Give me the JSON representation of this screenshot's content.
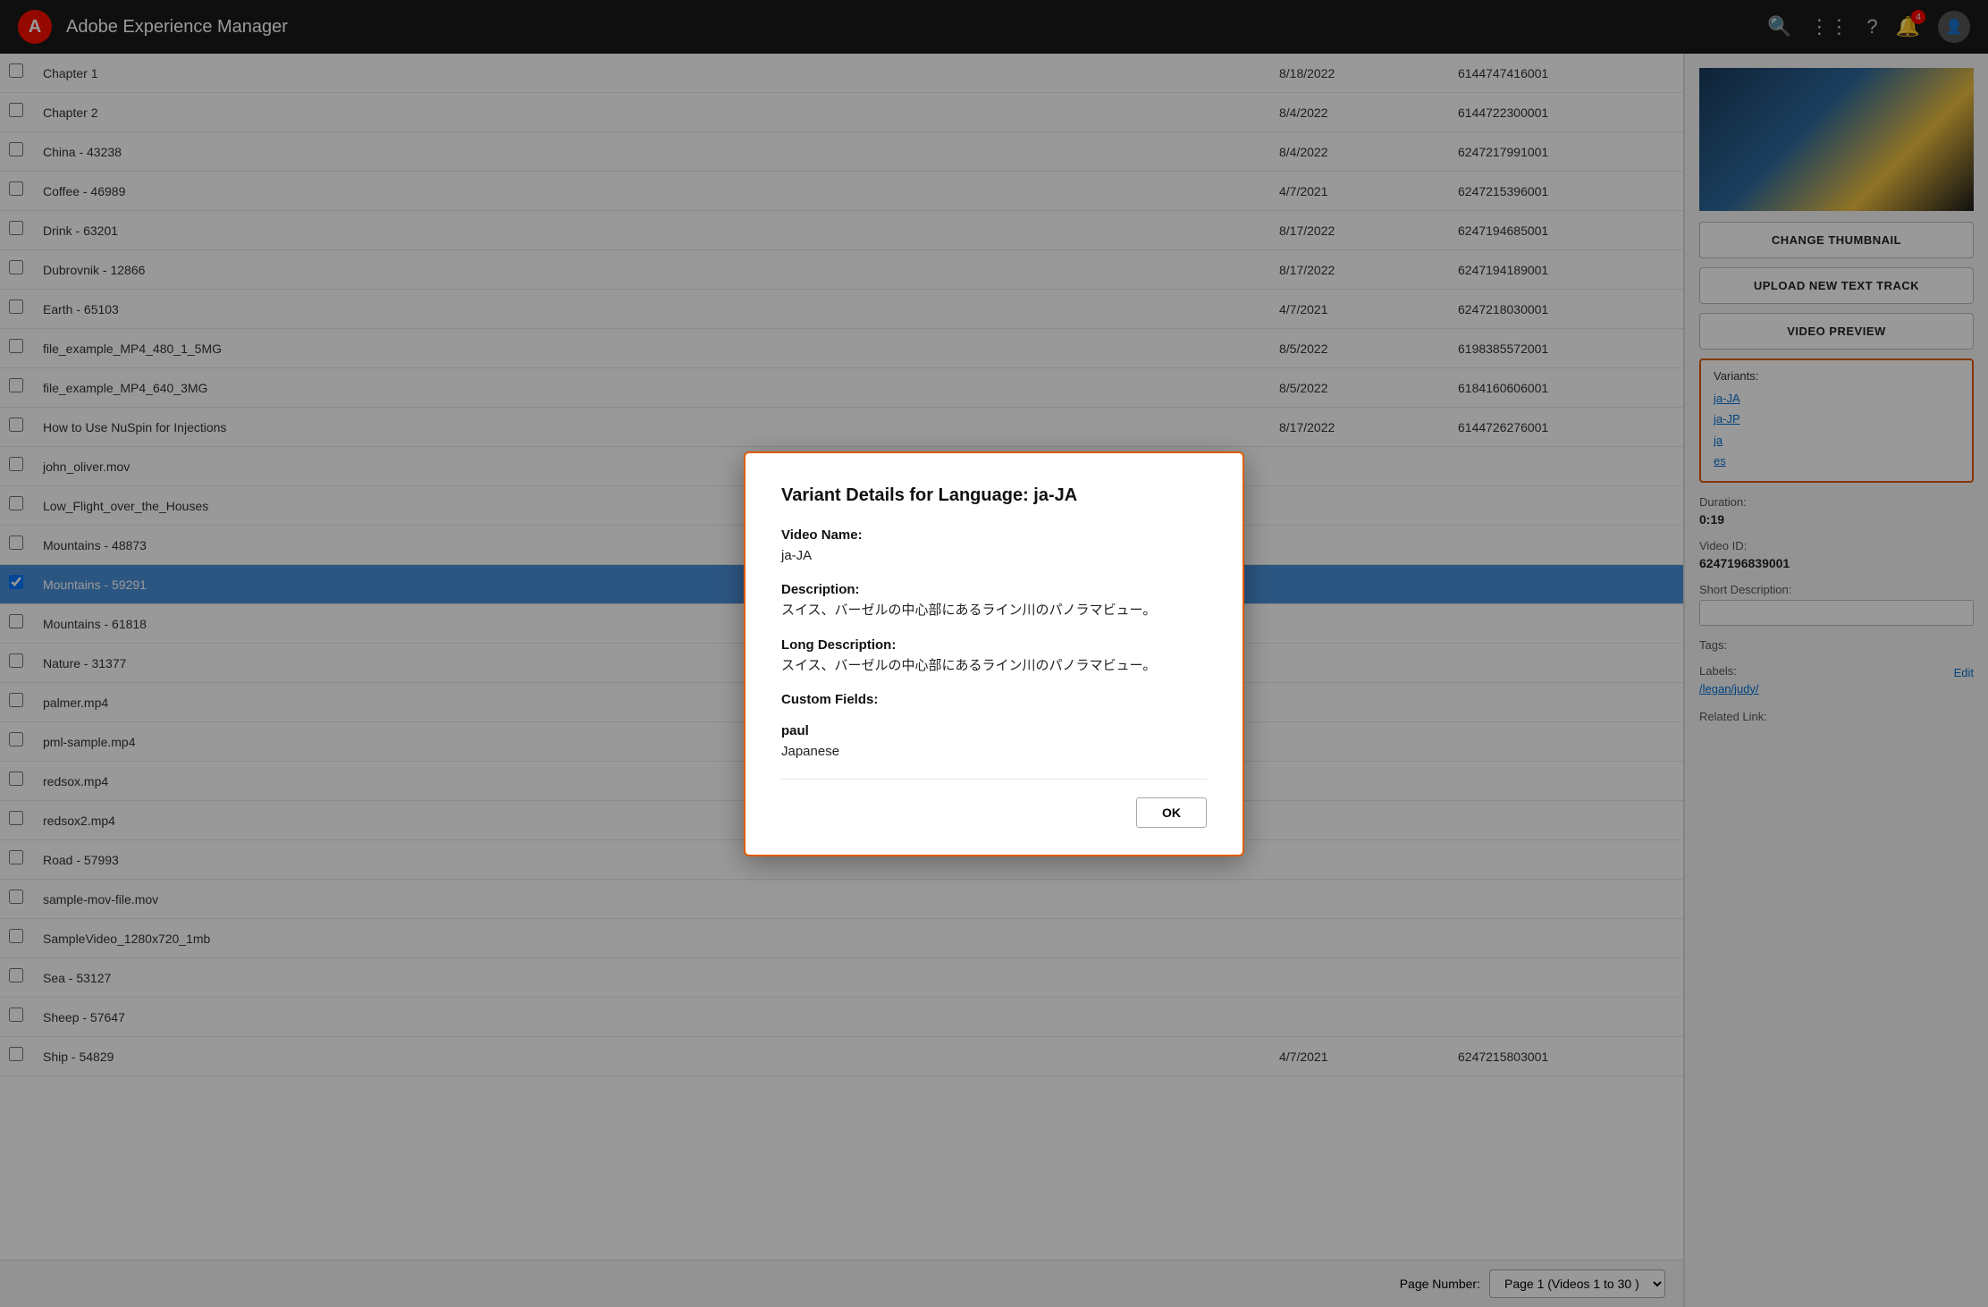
{
  "app": {
    "title": "Adobe Experience Manager",
    "logo": "A"
  },
  "nav": {
    "badge_count": "4"
  },
  "list": {
    "rows": [
      {
        "name": "Chapter 1",
        "date": "8/18/2022",
        "id": "6144747416001"
      },
      {
        "name": "Chapter 2",
        "date": "8/4/2022",
        "id": "6144722300001"
      },
      {
        "name": "China - 43238",
        "date": "8/4/2022",
        "id": "6247217991001"
      },
      {
        "name": "Coffee - 46989",
        "date": "4/7/2021",
        "id": "6247215396001"
      },
      {
        "name": "Drink - 63201",
        "date": "8/17/2022",
        "id": "6247194685001"
      },
      {
        "name": "Dubrovnik - 12866",
        "date": "8/17/2022",
        "id": "6247194189001"
      },
      {
        "name": "Earth - 65103",
        "date": "4/7/2021",
        "id": "6247218030001"
      },
      {
        "name": "file_example_MP4_480_1_5MG",
        "date": "8/5/2022",
        "id": "6198385572001"
      },
      {
        "name": "file_example_MP4_640_3MG",
        "date": "8/5/2022",
        "id": "6184160606001"
      },
      {
        "name": "How to Use NuSpin for Injections",
        "date": "8/17/2022",
        "id": "6144726276001"
      },
      {
        "name": "john_oliver.mov",
        "date": "",
        "id": ""
      },
      {
        "name": "Low_Flight_over_the_Houses",
        "date": "",
        "id": ""
      },
      {
        "name": "Mountains - 48873",
        "date": "",
        "id": ""
      },
      {
        "name": "Mountains - 59291",
        "date": "",
        "id": "",
        "selected": true
      },
      {
        "name": "Mountains - 61818",
        "date": "",
        "id": ""
      },
      {
        "name": "Nature - 31377",
        "date": "",
        "id": ""
      },
      {
        "name": "palmer.mp4",
        "date": "",
        "id": ""
      },
      {
        "name": "pml-sample.mp4",
        "date": "",
        "id": ""
      },
      {
        "name": "redsox.mp4",
        "date": "",
        "id": ""
      },
      {
        "name": "redsox2.mp4",
        "date": "",
        "id": ""
      },
      {
        "name": "Road - 57993",
        "date": "",
        "id": ""
      },
      {
        "name": "sample-mov-file.mov",
        "date": "",
        "id": ""
      },
      {
        "name": "SampleVideo_1280x720_1mb",
        "date": "",
        "id": ""
      },
      {
        "name": "Sea - 53127",
        "date": "",
        "id": ""
      },
      {
        "name": "Sheep - 57647",
        "date": "",
        "id": ""
      },
      {
        "name": "Ship - 54829",
        "date": "4/7/2021",
        "id": "6247215803001"
      }
    ],
    "pagination_label": "Page Number:",
    "pagination_value": "Page 1 (Videos 1 to 30 )",
    "to_30_text": "to 30"
  },
  "right_panel": {
    "change_thumbnail_btn": "CHANGE THUMBNAIL",
    "upload_text_track_btn": "UPLOAD NEW TEXT TRACK",
    "video_preview_btn": "VIDEO PREVIEW",
    "variants": {
      "title": "Variants:",
      "items": [
        "ja-JA",
        "ja-JP",
        "ja",
        "es"
      ]
    },
    "duration_label": "Duration:",
    "duration_value": "0:19",
    "video_id_label": "Video ID:",
    "video_id_value": "6247196839001",
    "short_description_label": "Short Description:",
    "short_description_placeholder": "",
    "tags_label": "Tags:",
    "labels_label": "Labels:",
    "labels_edit": "Edit",
    "labels_link": "/legan/judy/",
    "related_link_label": "Related Link:"
  },
  "modal": {
    "title": "Variant Details for Language: ja-JA",
    "video_name_label": "Video Name:",
    "video_name_value": "ja-JA",
    "description_label": "Description:",
    "description_value": "スイス、バーゼルの中心部にあるライン川のパノラマビュー。",
    "long_description_label": "Long Description:",
    "long_description_value": "スイス、バーゼルの中心部にあるライン川のパノラマビュー。",
    "custom_fields_label": "Custom Fields:",
    "paul_label": "paul",
    "paul_value": "Japanese",
    "ok_btn": "OK"
  }
}
